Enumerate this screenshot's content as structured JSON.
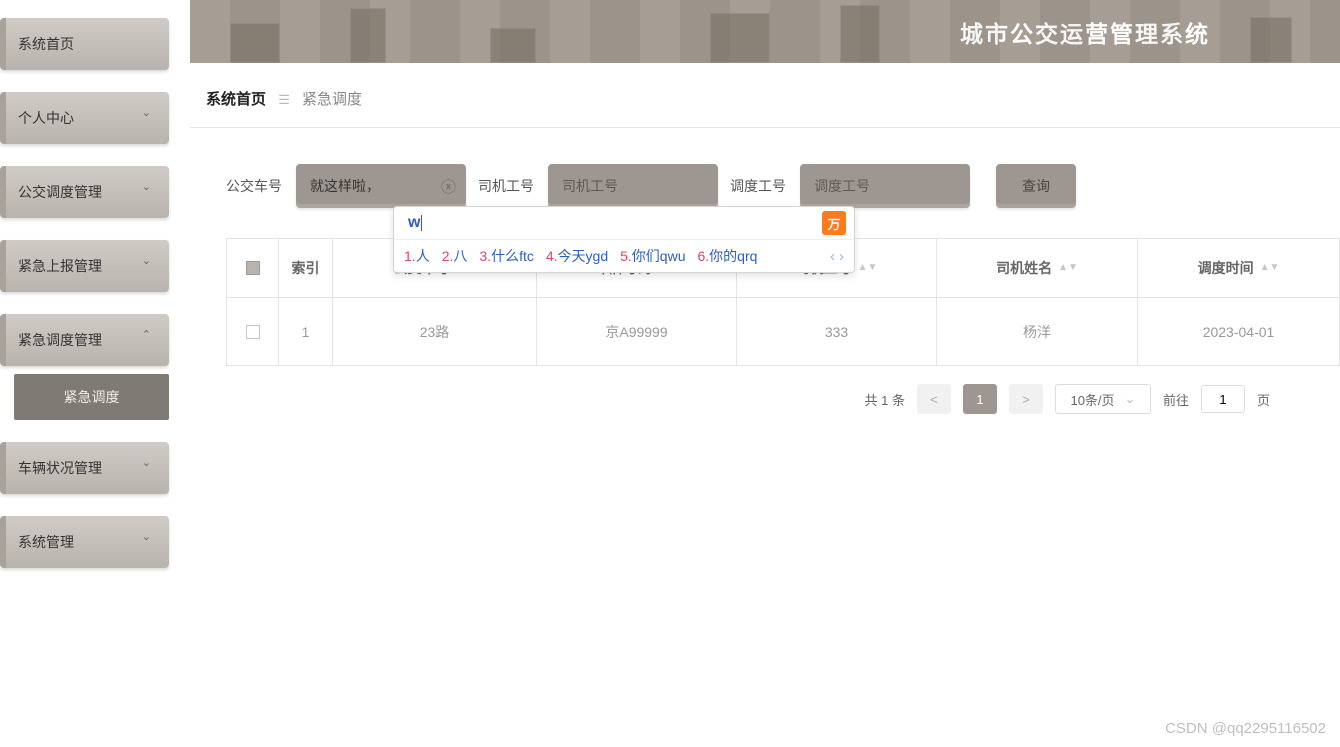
{
  "sidebar": {
    "items": [
      "系统首页",
      "个人中心",
      "公交调度管理",
      "紧急上报管理",
      "紧急调度管理",
      "车辆状况管理",
      "系统管理"
    ],
    "sub": "紧急调度"
  },
  "banner": {
    "title": "城市公交运营管理系统"
  },
  "breadcrumb": {
    "home": "系统首页",
    "current": "紧急调度"
  },
  "search": {
    "bus_label": "公交车号",
    "bus_value": "就这样啦，",
    "driver_label": "司机工号",
    "driver_ph": "司机工号",
    "dispatch_label": "调度工号",
    "dispatch_ph": "调度工号",
    "btn": "查询"
  },
  "table": {
    "headers": {
      "idx": "索引",
      "bus": "公交车号",
      "plate": "车牌号码",
      "did": "司机工号",
      "dname": "司机姓名",
      "time": "调度时间"
    },
    "rows": [
      {
        "idx": "1",
        "bus": "23路",
        "plate": "京A99999",
        "did": "333",
        "dname": "杨洋",
        "time": "2023-04-01"
      }
    ]
  },
  "pager": {
    "total": "共 1 条",
    "prev": "<",
    "page": "1",
    "next": ">",
    "size": "10条/页",
    "goto_pre": "前往",
    "goto_val": "1",
    "goto_suf": "页"
  },
  "ime": {
    "input": "w",
    "cands": [
      {
        "n": "1.",
        "t": "人",
        "p": ""
      },
      {
        "n": "2.",
        "t": "八",
        "p": ""
      },
      {
        "n": "3.",
        "t": "什么",
        "p": "ftc"
      },
      {
        "n": "4.",
        "t": "今天",
        "p": "ygd"
      },
      {
        "n": "5.",
        "t": "你们",
        "p": "qwu"
      },
      {
        "n": "6.",
        "t": "你的",
        "p": "qrq"
      }
    ],
    "logo": "万"
  },
  "watermark": "CSDN @qq2295116502"
}
